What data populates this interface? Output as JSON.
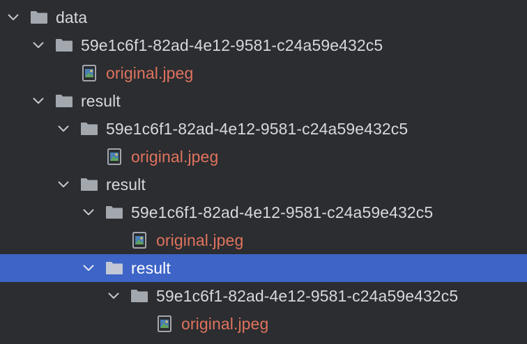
{
  "window": {
    "title": "Project tree"
  },
  "tree": {
    "rows": [
      {
        "label": "data",
        "kind": "folder",
        "depth": 0,
        "expanded": true,
        "selected": false
      },
      {
        "label": "59e1c6f1-82ad-4e12-9581-c24a59e432c5",
        "kind": "folder",
        "depth": 1,
        "expanded": true,
        "selected": false
      },
      {
        "label": "original.jpeg",
        "kind": "image-file",
        "depth": 2,
        "expanded": false,
        "selected": false
      },
      {
        "label": "result",
        "kind": "folder",
        "depth": 1,
        "expanded": true,
        "selected": false
      },
      {
        "label": "59e1c6f1-82ad-4e12-9581-c24a59e432c5",
        "kind": "folder",
        "depth": 2,
        "expanded": true,
        "selected": false
      },
      {
        "label": "original.jpeg",
        "kind": "image-file",
        "depth": 3,
        "expanded": false,
        "selected": false
      },
      {
        "label": "result",
        "kind": "folder",
        "depth": 2,
        "expanded": true,
        "selected": false
      },
      {
        "label": "59e1c6f1-82ad-4e12-9581-c24a59e432c5",
        "kind": "folder",
        "depth": 3,
        "expanded": true,
        "selected": false
      },
      {
        "label": "original.jpeg",
        "kind": "image-file",
        "depth": 4,
        "expanded": false,
        "selected": false
      },
      {
        "label": "result",
        "kind": "folder",
        "depth": 3,
        "expanded": true,
        "selected": true
      },
      {
        "label": "59e1c6f1-82ad-4e12-9581-c24a59e432c5",
        "kind": "folder",
        "depth": 4,
        "expanded": true,
        "selected": false
      },
      {
        "label": "original.jpeg",
        "kind": "image-file",
        "depth": 5,
        "expanded": false,
        "selected": false
      }
    ]
  },
  "colors": {
    "background": "#2b2d30",
    "text": "#d5d8de",
    "file_text": "#e0735e",
    "selection": "#3d64c6",
    "folder_icon": "#a3a7ae"
  },
  "icons": {
    "folder": "folder-icon",
    "image_file": "image-file-icon",
    "expanded": "chevron-down-icon"
  }
}
